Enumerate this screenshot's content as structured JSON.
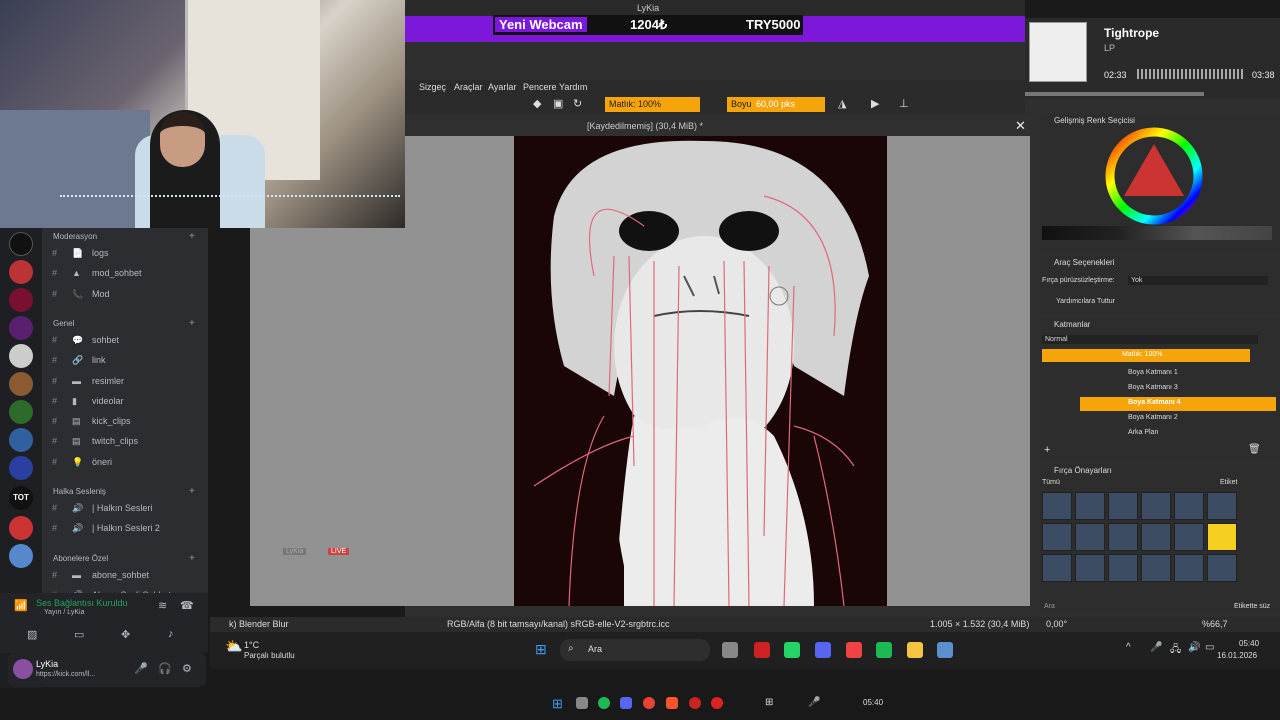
{
  "stream": {
    "window_title": "LyKia",
    "ticker_label": "Yeni Webcam",
    "ticker_amount": "1204₺",
    "ticker_goal": "TRY5000"
  },
  "now_playing": {
    "song": "Tightrope",
    "artist": "LP",
    "time_elapsed": "02:33",
    "time_total": "03:38",
    "progress": 0.7
  },
  "krita": {
    "menu": [
      "Sizgeç",
      "Araçlar",
      "Ayarlar",
      "Pencere",
      "Yardım"
    ],
    "toolbar": {
      "opacity": "Matlık: 100%",
      "size_label": "Boyu",
      "size_value": "60,00 pks"
    },
    "doc_title": "[Kaydedilmemiş]  (30,4 MiB) *",
    "docks": {
      "color": "Gelişmiş Renk Seçicisi",
      "tool_options": "Araç Seçenekleri",
      "smoothing_label": "Fırça pürüzsüzleştirme:",
      "smoothing_value": "Yok",
      "assist": "Yardımcılara Tuttur",
      "layers": "Katmanlar",
      "blend": "Normal",
      "layer_opacity": "Matlık:  100%",
      "layer_list": [
        "Boya Katmanı 1",
        "Boya Katmanı 3",
        "Boya Katmanı 4",
        "Boya Katmanı 2",
        "Arka Plan"
      ],
      "presets": "Fırça Önayarları",
      "presets_filter": "Tümü",
      "presets_tag": "Etiket",
      "search": "Ara",
      "tag_search": "Etikette süz"
    },
    "status": {
      "brush": "k) Blender Blur",
      "color_profile": "RGB/Alfa (8 bit tamsayı/kanal)  sRGB-elle-V2-srgbtrc.icc",
      "dimensions": "1.005 × 1.532 (30,4 MiB)",
      "angle": "0,00°",
      "zoom": "%66,7"
    }
  },
  "discord": {
    "categories": [
      {
        "name": "Moderasyon",
        "channels": [
          {
            "name": "logs",
            "glyph": "📄"
          },
          {
            "name": "mod_sohbet",
            "glyph": "▲"
          },
          {
            "name": "Mod",
            "glyph": "📞"
          }
        ]
      },
      {
        "name": "Genel",
        "channels": [
          {
            "name": "sohbet",
            "glyph": "💬"
          },
          {
            "name": "link",
            "glyph": "🔗"
          },
          {
            "name": "resimler",
            "glyph": "▬"
          },
          {
            "name": "videolar",
            "glyph": "▮"
          },
          {
            "name": "kick_clips",
            "glyph": "▤"
          },
          {
            "name": "twitch_clips",
            "glyph": "▤"
          },
          {
            "name": "öneri",
            "glyph": "💡"
          }
        ]
      },
      {
        "name": "Halka Sesleniş",
        "channels": [
          {
            "name": "| Halkın Sesleri",
            "glyph": "🔊"
          },
          {
            "name": "| Halkın Sesleri 2",
            "glyph": "🔊"
          }
        ]
      },
      {
        "name": "Abonelere Özel",
        "channels": [
          {
            "name": "abone_sohbet",
            "glyph": "▬"
          },
          {
            "name": "Abone Sesli Sohbet",
            "glyph": "🔊"
          }
        ]
      }
    ],
    "voice_status": "Ses Bağlantısı Kuruldu",
    "voice_channel": "Yayın / LyKia",
    "username": "LyKia",
    "user_status": "https://kick.com/ll...",
    "server_label": "TOT"
  },
  "overlay": {
    "user": "LyKia",
    "badge": "LIVE"
  },
  "taskbar": {
    "weather_temp": "1°C",
    "weather_desc": "Parçalı bulutlu",
    "search": "Ara",
    "time": "05:40",
    "date": "16.01.2026",
    "time2": "05:40"
  },
  "colors": {
    "accent": "#f5a40a",
    "stream_purple": "#7b18d9",
    "discord_bg": "#2b2d31"
  }
}
